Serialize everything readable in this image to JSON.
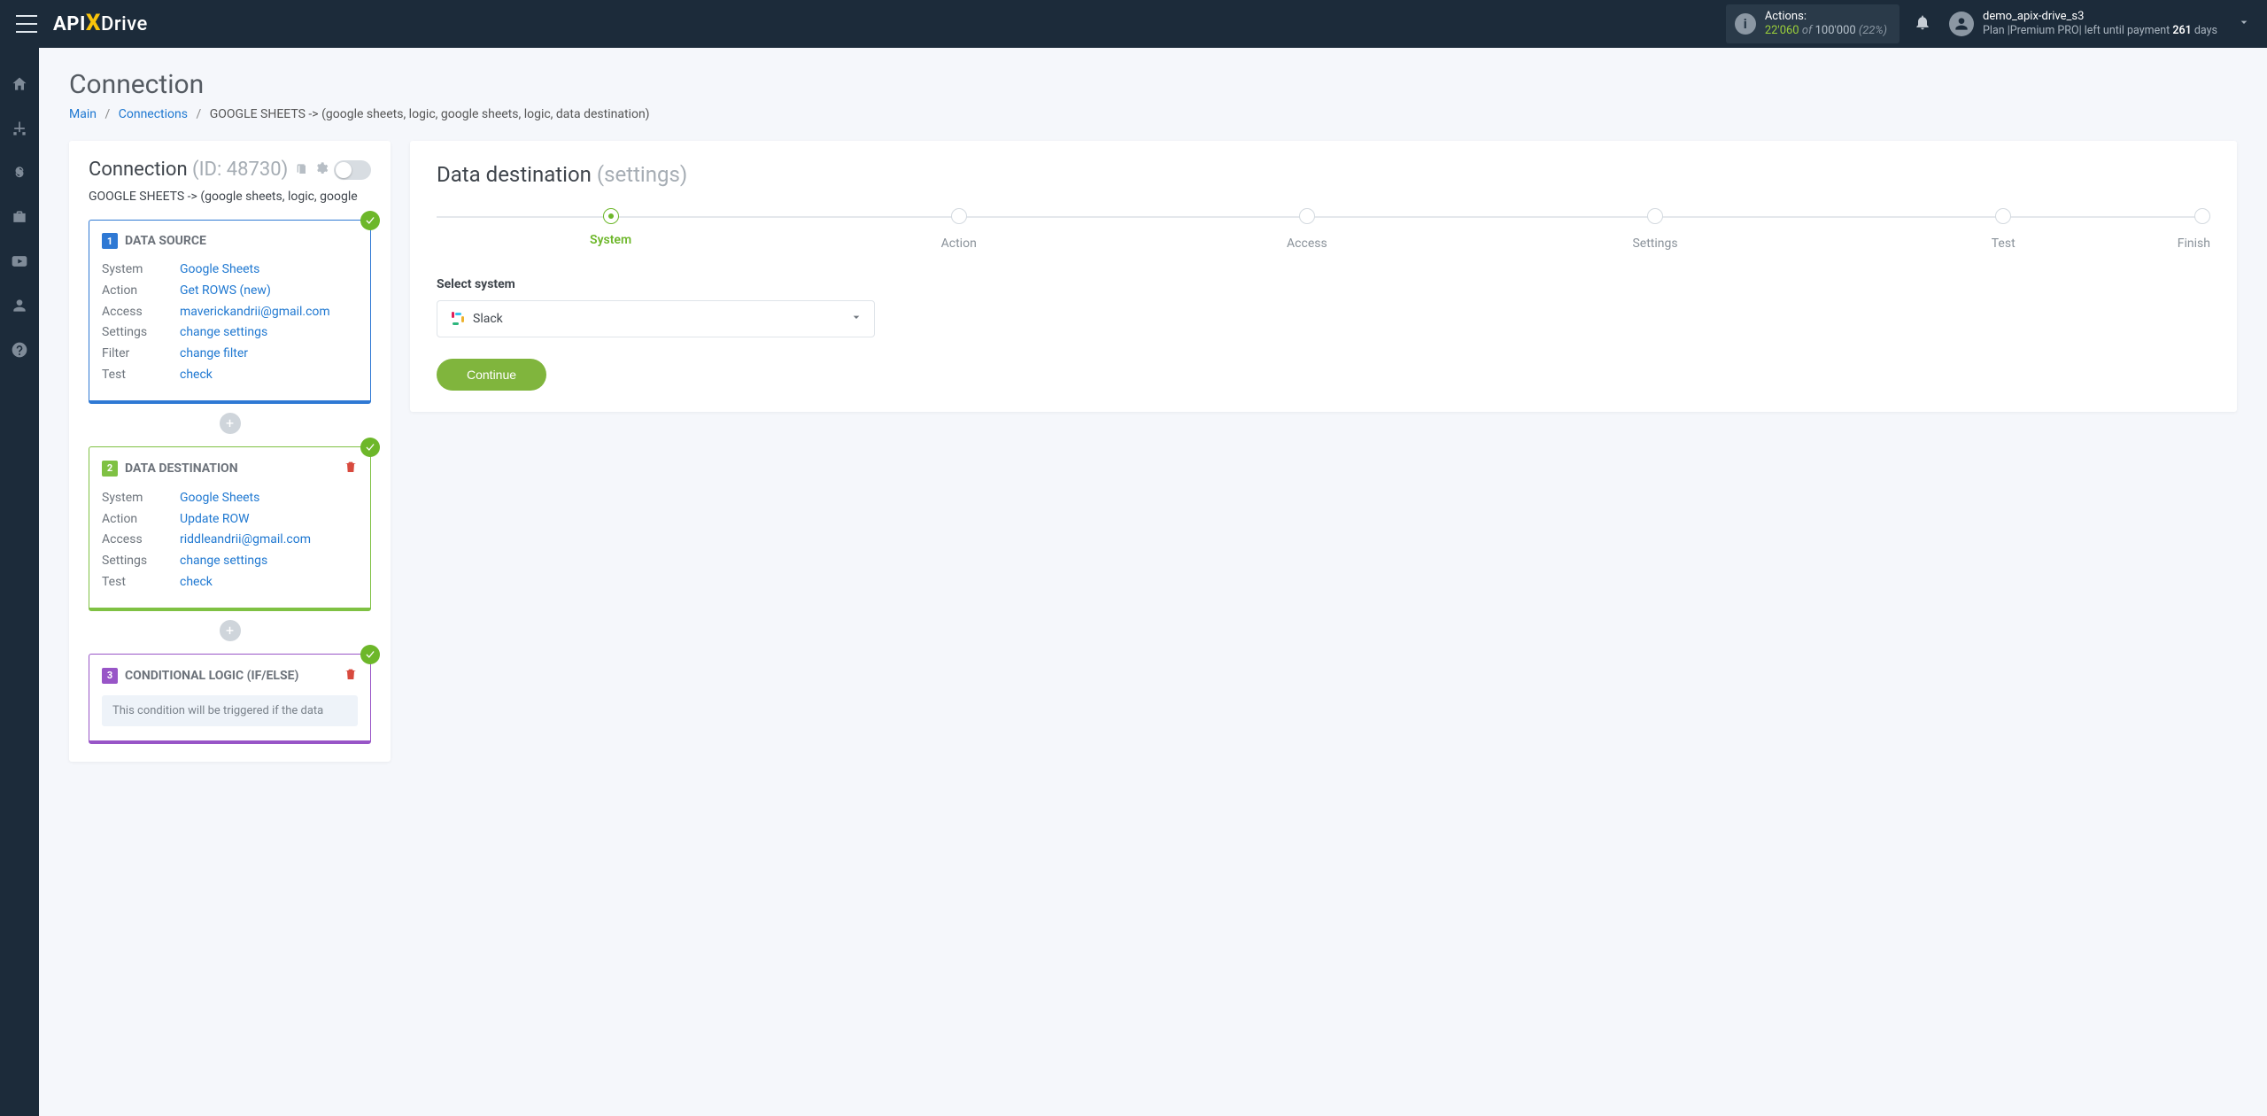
{
  "header": {
    "logo_part1": "API",
    "logo_x": "X",
    "logo_part2": "Drive",
    "actions_label": "Actions:",
    "actions_count": "22'060",
    "actions_of": " of ",
    "actions_total": "100'000",
    "actions_pct": " (22%)",
    "user_name": "demo_apix-drive_s3",
    "plan_prefix": "Plan |Premium PRO| left until payment ",
    "plan_days": "261",
    "plan_suffix": " days"
  },
  "page": {
    "title": "Connection",
    "crumb_main": "Main",
    "crumb_connections": "Connections",
    "crumb_current": "GOOGLE SHEETS -> (google sheets, logic, google sheets, logic, data destination)"
  },
  "side": {
    "head_label": "Connection ",
    "head_id": "(ID: 48730)",
    "pathline": "GOOGLE SHEETS -> (google sheets, logic, google",
    "ds": {
      "num": "1",
      "title": "DATA SOURCE",
      "system_k": "System",
      "system_v": "Google Sheets",
      "action_k": "Action",
      "action_v": "Get ROWS (new)",
      "access_k": "Access",
      "access_v": "maverickandrii@gmail.com",
      "settings_k": "Settings",
      "settings_v": "change settings",
      "filter_k": "Filter",
      "filter_v": "change filter",
      "test_k": "Test",
      "test_v": "check"
    },
    "dd": {
      "num": "2",
      "title": "DATA DESTINATION",
      "system_k": "System",
      "system_v": "Google Sheets",
      "action_k": "Action",
      "action_v": "Update ROW",
      "access_k": "Access",
      "access_v": "riddleandrii@gmail.com",
      "settings_k": "Settings",
      "settings_v": "change settings",
      "test_k": "Test",
      "test_v": "check"
    },
    "cl": {
      "num": "3",
      "title": "CONDITIONAL LOGIC (IF/ELSE)",
      "note": "This condition will be triggered if the data"
    },
    "plus": "+"
  },
  "right": {
    "title": "Data destination ",
    "subtitle": "(settings)",
    "steps": [
      "System",
      "Action",
      "Access",
      "Settings",
      "Test",
      "Finish"
    ],
    "select_label": "Select system",
    "select_value": "Slack",
    "continue": "Continue"
  }
}
